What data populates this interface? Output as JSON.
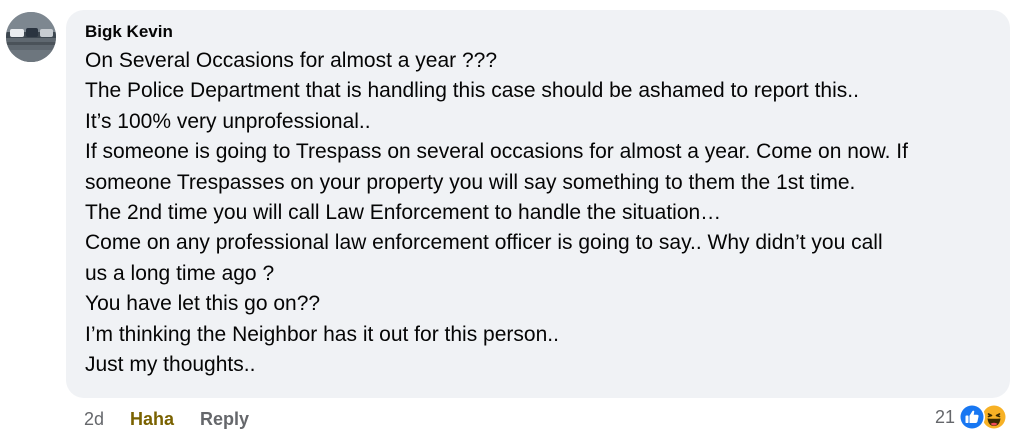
{
  "comment": {
    "author": "Bigk Kevin",
    "lines": [
      "On Several Occasions for almost a year ???",
      "The Police Department that is handling this case should be ashamed to report this..",
      "It’s 100% very unprofessional..",
      "If someone is going to Trespass on several occasions for almost a year. Come on now. If",
      "someone Trespasses on your property you will say something to them the 1st time.",
      "The 2nd time you will call Law Enforcement to handle the situation…",
      "Come on any professional law enforcement officer is going to say.. Why didn’t you call",
      "us a long time ago ?",
      "You have let this go on??",
      "I’m thinking the Neighbor has it out for this person..",
      "Just my thoughts.."
    ]
  },
  "actions": {
    "time": "2d",
    "reaction_label": "Haha",
    "reply_label": "Reply"
  },
  "reactions": {
    "count": "21",
    "icons": [
      "like-icon",
      "haha-icon"
    ],
    "like_color": "#1877f2",
    "haha_color": "#f7b125",
    "haha_text_color": "#7a6200"
  }
}
